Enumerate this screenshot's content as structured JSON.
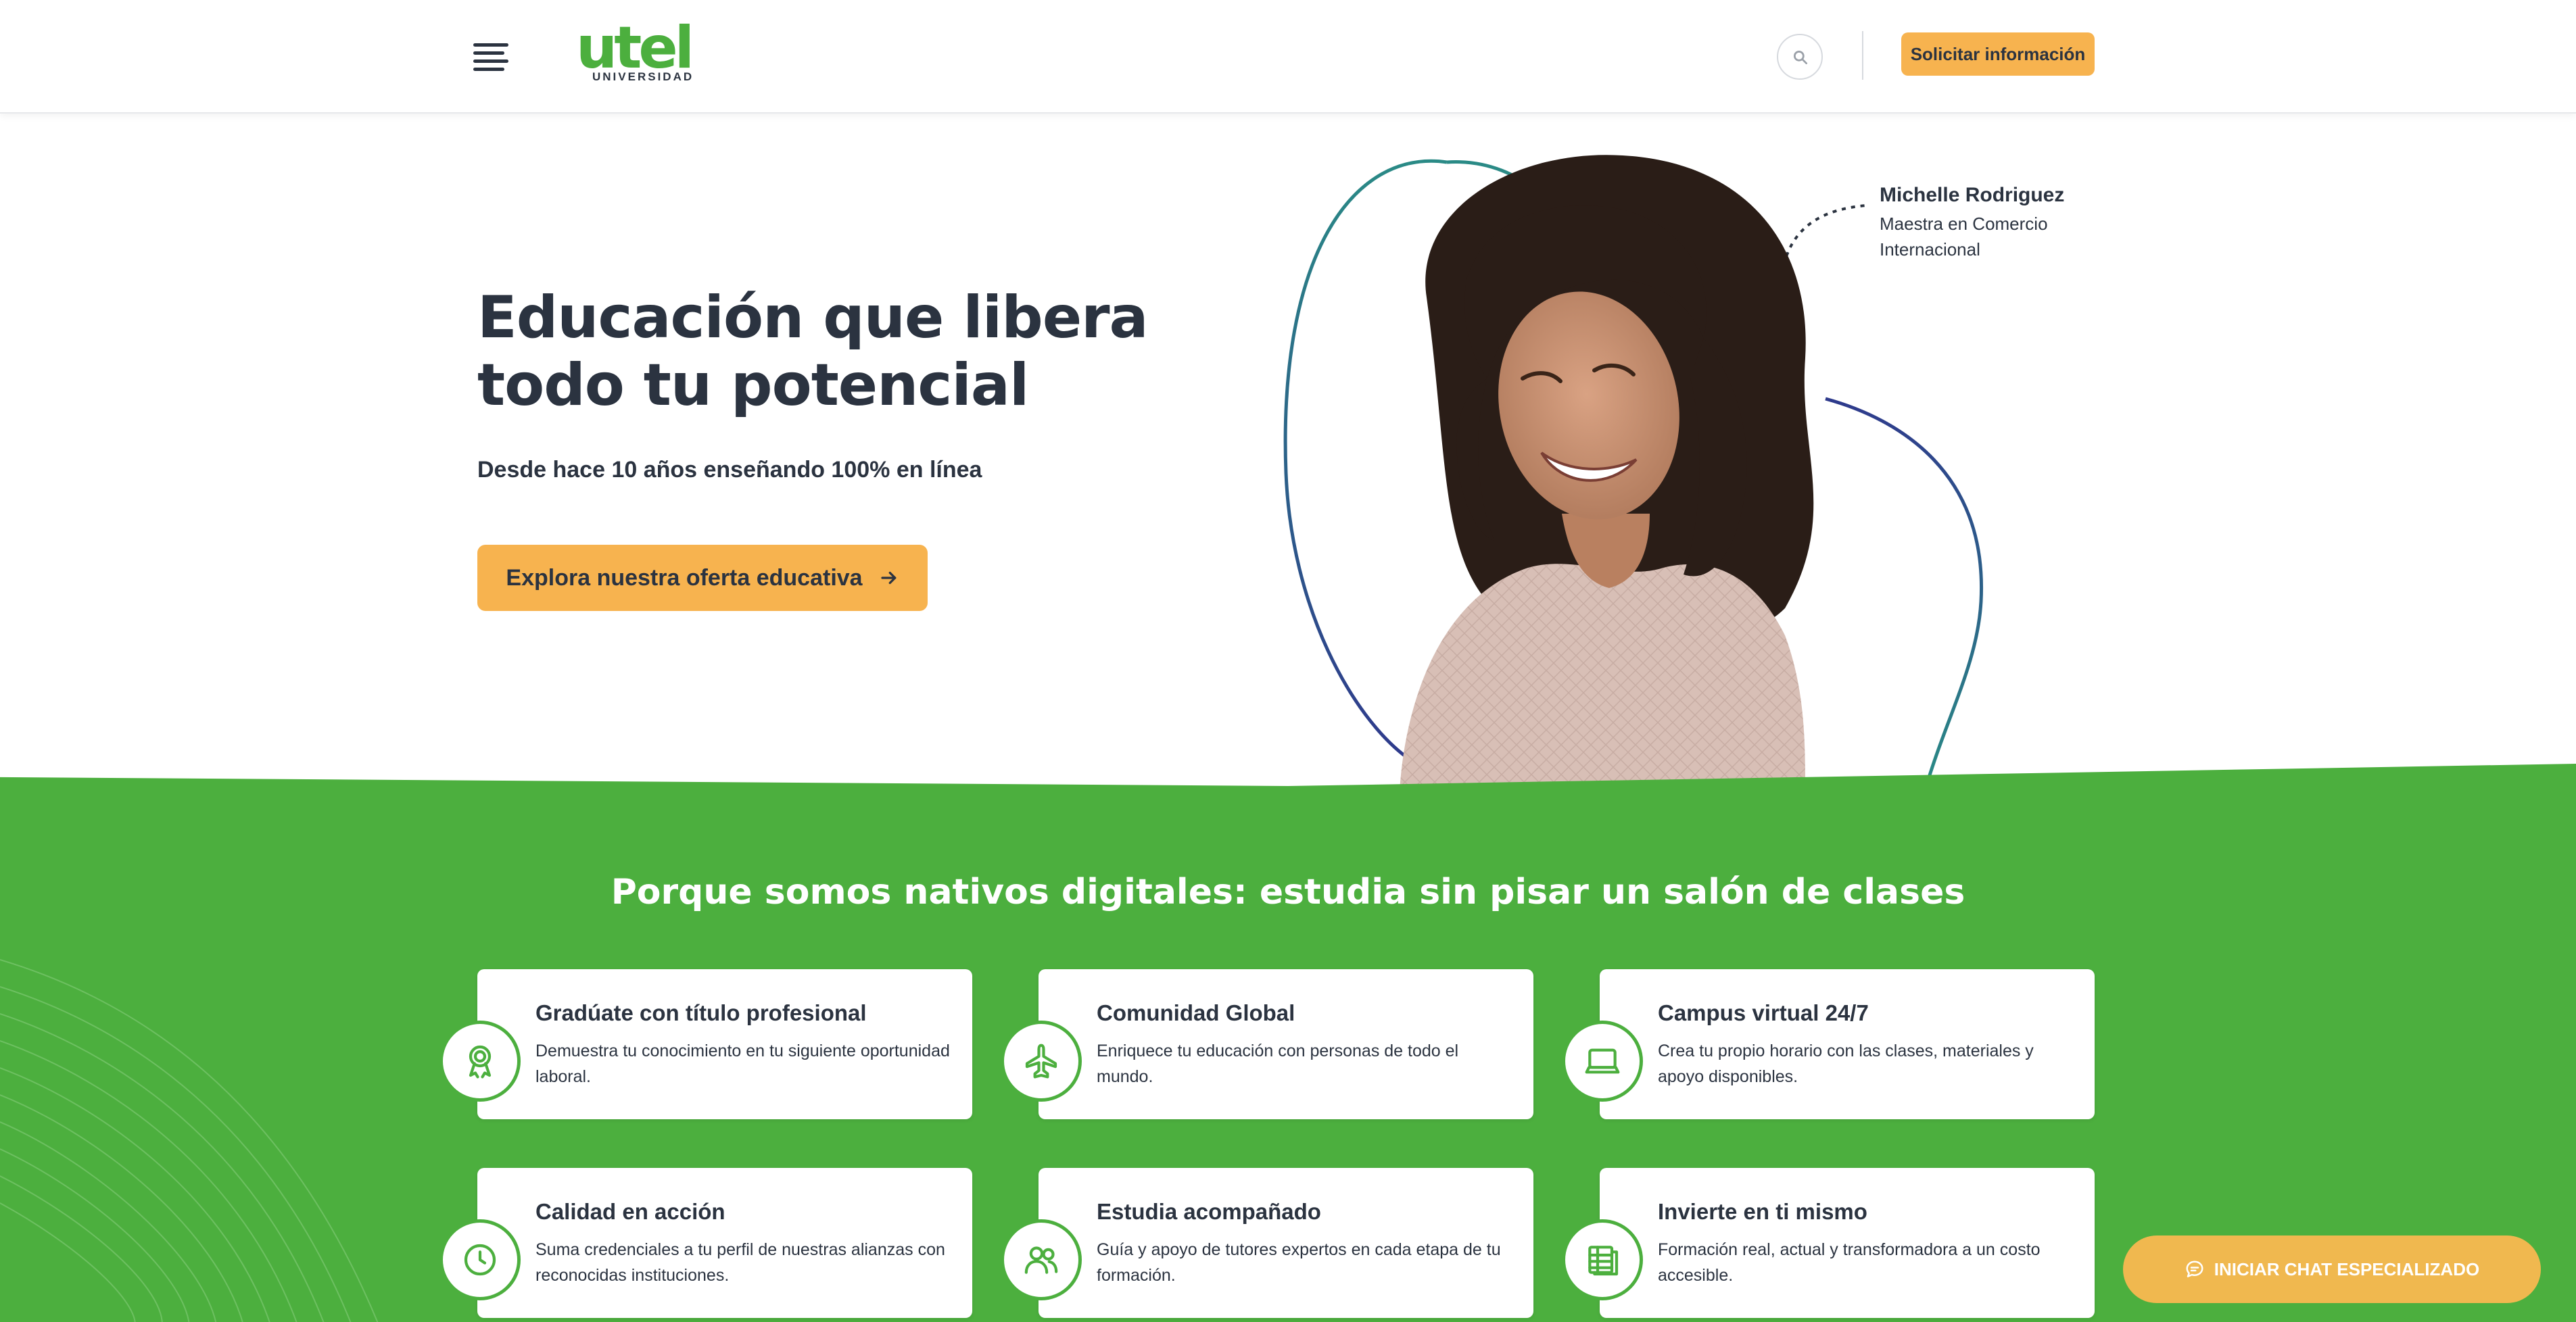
{
  "header": {
    "logo_text": "utel",
    "logo_subtext": "UNIVERSIDAD",
    "cta_label": "Solicitar información",
    "search_icon": "search-icon",
    "menu_icon": "hamburger-menu-icon"
  },
  "hero": {
    "title_line1": "Educación que libera",
    "title_line2": "todo tu potencial",
    "subtitle": "Desde hace 10 años enseñando 100% en línea",
    "cta_label": "Explora nuestra oferta educativa",
    "cta_icon": "arrow-right-icon",
    "person_name": "Michelle Rodriguez",
    "person_role": "Maestra en Comercio Internacional"
  },
  "features": {
    "title": "Porque somos nativos digitales: estudia sin pisar un salón de clases",
    "items": [
      {
        "title": "Gradúate con título profesional",
        "desc": "Demuestra tu conocimiento en tu siguiente oportunidad laboral.",
        "icon": "award-ribbon-icon"
      },
      {
        "title": "Comunidad Global",
        "desc": "Enriquece tu educación con personas de todo el mundo.",
        "icon": "airplane-icon"
      },
      {
        "title": "Campus virtual 24/7",
        "desc": "Crea tu propio horario con las clases, materiales y apoyo disponibles.",
        "icon": "laptop-icon"
      },
      {
        "title": "Calidad en acción",
        "desc": "Suma credenciales a tu perfil de nuestras alianzas con reconocidas instituciones.",
        "icon": "clock-icon"
      },
      {
        "title": "Estudia acompañado",
        "desc": "Guía y apoyo de tutores expertos en cada etapa de tu formación.",
        "icon": "users-icon"
      },
      {
        "title": "Invierte en ti mismo",
        "desc": "Formación real, actual y transformadora a un costo accesible.",
        "icon": "money-stack-icon"
      }
    ]
  },
  "chat": {
    "label": "INICIAR CHAT ESPECIALIZADO",
    "icon": "chat-bubble-icon"
  },
  "colors": {
    "brand_green": "#4caf3e",
    "accent_yellow": "#f7b34f",
    "text_dark": "#2b3340",
    "teal_line": "#2a8a86",
    "navy_line": "#2e3a8c"
  }
}
